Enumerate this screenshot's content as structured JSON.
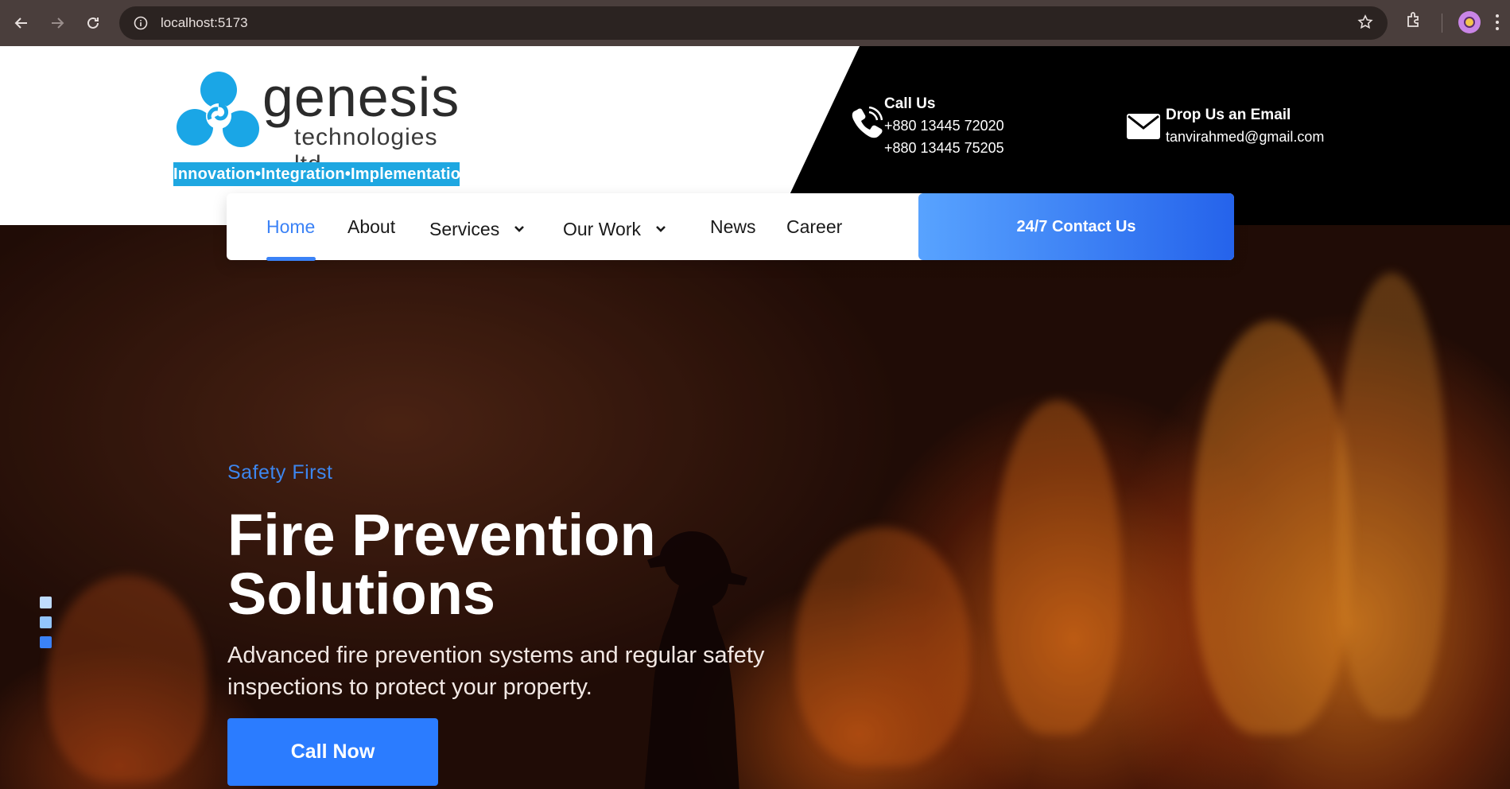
{
  "browser": {
    "url": "localhost:5173"
  },
  "logo": {
    "word": "genesis",
    "subtitle": "technologies ltd",
    "tagline": "Innovation•Integration•Implementation"
  },
  "contact": {
    "call_title": "Call Us",
    "phone_1": "+880 13445 72020",
    "phone_2": "+880 13445 75205",
    "email_title": "Drop Us an Email",
    "email": "tanvirahmed@gmail.com"
  },
  "nav": {
    "items": [
      {
        "label": "Home",
        "active": true
      },
      {
        "label": "About"
      },
      {
        "label": "Services",
        "dropdown": true
      },
      {
        "label": "Our Work",
        "dropdown": true
      },
      {
        "label": "News"
      },
      {
        "label": "Career"
      }
    ],
    "cta_label": "24/7 Contact Us"
  },
  "hero": {
    "eyebrow": "Safety First",
    "title": "Fire Prevention Solutions",
    "description": "Advanced fire prevention systems and regular safety inspections to protect your property.",
    "cta_label": "Call Now",
    "slide_count": 3,
    "active_slide": 3
  },
  "colors": {
    "accent": "#3b82f6",
    "cta_button": "#2b7cff",
    "header_dark": "#000000",
    "logo_blue": "#1ea7e1"
  }
}
